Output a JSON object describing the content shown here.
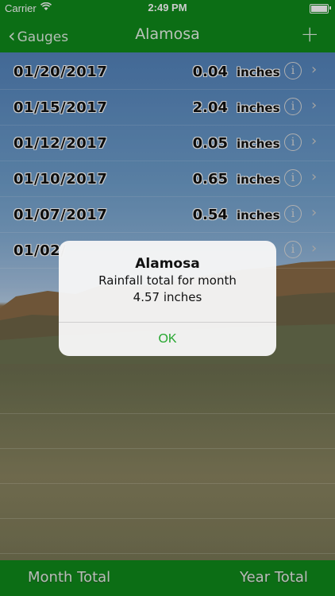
{
  "status_bar": {
    "carrier": "Carrier",
    "time": "2:49 PM"
  },
  "nav": {
    "back_label": "Gauges",
    "title": "Alamosa"
  },
  "rows": [
    {
      "date": "01/20/2017",
      "value": "0.04",
      "unit": "inches"
    },
    {
      "date": "01/15/2017",
      "value": "2.04",
      "unit": "inches"
    },
    {
      "date": "01/12/2017",
      "value": "0.05",
      "unit": "inches"
    },
    {
      "date": "01/10/2017",
      "value": "0.65",
      "unit": "inches"
    },
    {
      "date": "01/07/2017",
      "value": "0.54",
      "unit": "inches"
    },
    {
      "date": "01/02/",
      "value": "",
      "unit": ""
    }
  ],
  "alert": {
    "title": "Alamosa",
    "message_line1": "Rainfall total for month",
    "message_line2": "4.57 inches",
    "ok_label": "OK"
  },
  "tabbar": {
    "month_total": "Month Total",
    "year_total": "Year Total"
  },
  "colors": {
    "bar_green": "#0f8a1b",
    "ok_green": "#24a62d"
  }
}
